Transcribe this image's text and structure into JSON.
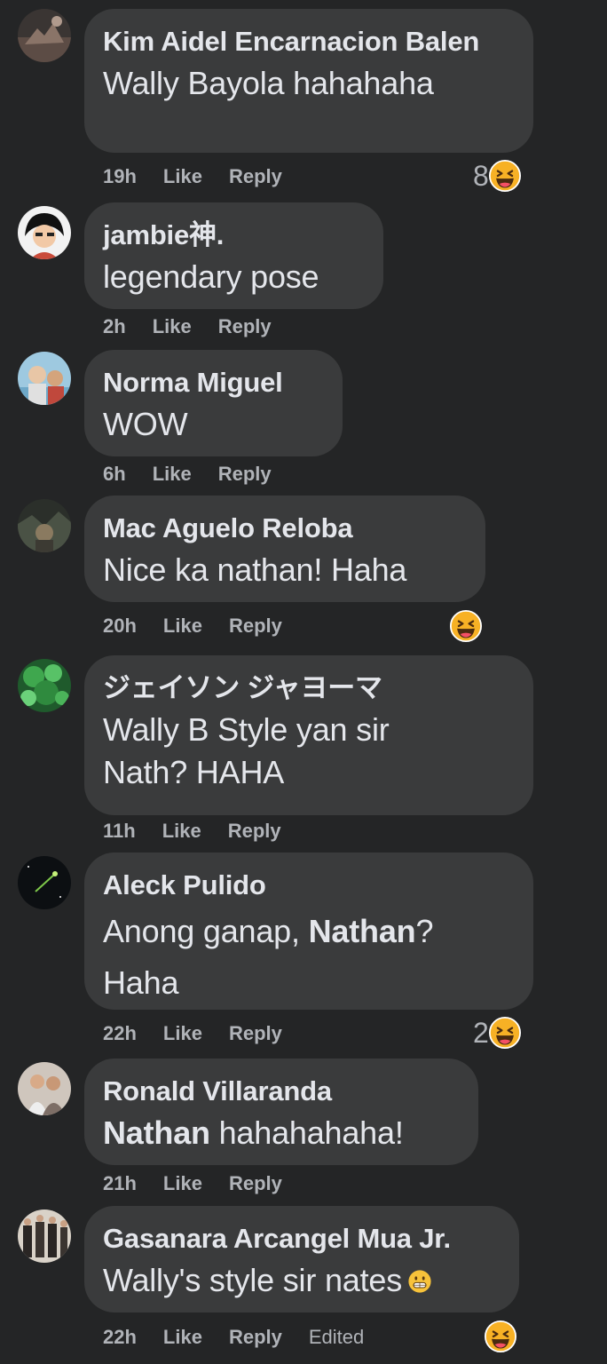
{
  "comments": [
    {
      "author": "Kim Aidel Encarnacion Balen",
      "text": "Wally Bayola hahahaha",
      "time": "19h",
      "like": "Like",
      "reply": "Reply",
      "reaction_count": "8"
    },
    {
      "author": "jambie神.",
      "text": "legendary pose",
      "time": "2h",
      "like": "Like",
      "reply": "Reply"
    },
    {
      "author": "Norma Miguel",
      "text": "WOW",
      "time": "6h",
      "like": "Like",
      "reply": "Reply"
    },
    {
      "author": "Mac Aguelo Reloba",
      "text": "Nice ka nathan! Haha",
      "time": "20h",
      "like": "Like",
      "reply": "Reply",
      "reaction_count": ""
    },
    {
      "author": "ジェイソン ジャヨーマ",
      "text": "Wally B Style yan sir Nath? HAHA",
      "time": "11h",
      "like": "Like",
      "reply": "Reply"
    },
    {
      "author": "Aleck Pulido",
      "text_pre": "Anong ganap, ",
      "mention": "Nathan",
      "text_post": "? Haha",
      "time": "22h",
      "like": "Like",
      "reply": "Reply",
      "reaction_count": "2"
    },
    {
      "author": "Ronald Villaranda",
      "mention": "Nathan",
      "text_post": " hahahahaha!",
      "time": "21h",
      "like": "Like",
      "reply": "Reply"
    },
    {
      "author": "Gasanara Arcangel Mua Jr.",
      "text": "Wally's style sir nates",
      "time": "22h",
      "like": "Like",
      "reply": "Reply",
      "edited": "Edited",
      "reaction_count": ""
    }
  ],
  "colors": {
    "background": "#242526",
    "bubble": "#3a3b3c",
    "text": "#e4e6eb",
    "meta": "#b0b3b8",
    "emoji": "#f7b125"
  },
  "icons": {
    "reaction": "haha-emoji-icon",
    "inline": "grin-emoji-icon"
  }
}
